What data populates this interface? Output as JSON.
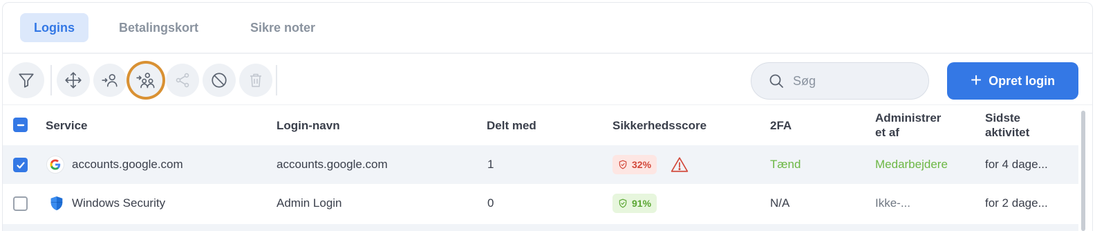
{
  "tabs": [
    {
      "label": "Logins",
      "active": true
    },
    {
      "label": "Betalingskort",
      "active": false
    },
    {
      "label": "Sikre noter",
      "active": false
    }
  ],
  "toolbar": {
    "buttons": [
      {
        "icon": "filter-icon"
      },
      {
        "icon": "move-icon"
      },
      {
        "icon": "assign-user-icon"
      },
      {
        "icon": "assign-group-icon"
      },
      {
        "icon": "share-icon"
      },
      {
        "icon": "block-icon"
      },
      {
        "icon": "trash-icon"
      }
    ],
    "search_placeholder": "Søg",
    "create_label": "Opret login",
    "create_plus": "+"
  },
  "table": {
    "columns": {
      "service": "Service",
      "login_name": "Login-navn",
      "shared_with": "Delt med",
      "security_score": "Sikkerhedsscore",
      "twofa": "2FA",
      "managed_by_1": "Administrer",
      "managed_by_2": "et af",
      "last_activity_1": "Sidste",
      "last_activity_2": "aktivitet"
    },
    "rows": [
      {
        "checked": true,
        "service": "accounts.google.com",
        "favicon": "google-icon",
        "login_name": "accounts.google.com",
        "shared_with": "1",
        "score": "32%",
        "score_level": "weak",
        "warning": true,
        "twofa": "Tænd",
        "managed_by": "Medarbejdere",
        "last_activity": "for 4 dage..."
      },
      {
        "checked": false,
        "service": "Windows Security",
        "favicon": "windows-security-shield-icon",
        "login_name": "Admin Login",
        "shared_with": "0",
        "score": "91%",
        "score_level": "strong",
        "warning": false,
        "twofa": "N/A",
        "managed_by": "Ikke-...",
        "last_activity": "for 2 dage..."
      }
    ]
  },
  "colors": {
    "accent": "#3478e5",
    "tab_active_bg": "#dce8fb",
    "highlight_ring": "#d99133",
    "weak": "#d2483a",
    "strong": "#5aa632"
  }
}
